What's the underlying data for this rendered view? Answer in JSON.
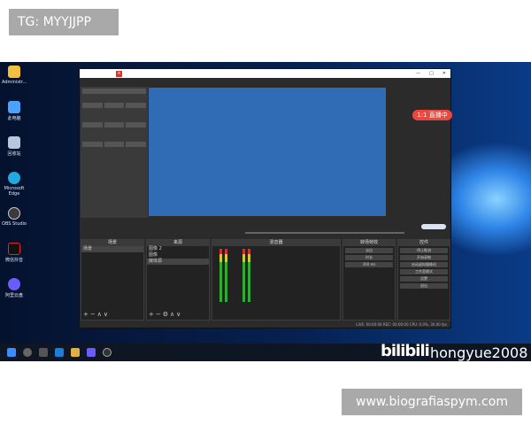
{
  "watermark_top": "TG: MYYJJPP",
  "watermark_bottom": "www.biografiaspym.com",
  "preview": {
    "live_badge": "1:1 直播中"
  },
  "overlay": {
    "bili": "bilibili",
    "user": "hongyue2008"
  },
  "desktop_icons": [
    {
      "label": "Administr...",
      "color": "#f0c040"
    },
    {
      "label": "此电脑",
      "color": "#4aa3ff"
    },
    {
      "label": "回收站",
      "color": "#b7c7dd"
    },
    {
      "label": "Microsoft Edge",
      "color": "#23a8e0"
    },
    {
      "label": "OBS Studio",
      "color": "#3b3b3b"
    },
    {
      "label": "微信抖音",
      "color": "#111111"
    },
    {
      "label": "阿里云盘",
      "color": "#6b5cff"
    }
  ],
  "docks": {
    "scenes": {
      "title": "场景",
      "items": [
        "场景"
      ]
    },
    "sources": {
      "title": "来源",
      "items": [
        "图像 2",
        "图像",
        "媒体源"
      ]
    },
    "mixer": {
      "title": "混音器"
    },
    "transitions": {
      "title": "转场特效",
      "selected": "淡出",
      "duration_label": "时长",
      "duration": "300 ms"
    },
    "controls": {
      "title": "控件",
      "buttons": [
        "停止推流",
        "开始录制",
        "启动虚拟摄像机",
        "工作室模式",
        "设置",
        "退出"
      ]
    }
  },
  "status": {
    "text": "LIVE: 00:00:00  REC: 00:00:00  CPU: 0.0%, 30.00 fps"
  }
}
